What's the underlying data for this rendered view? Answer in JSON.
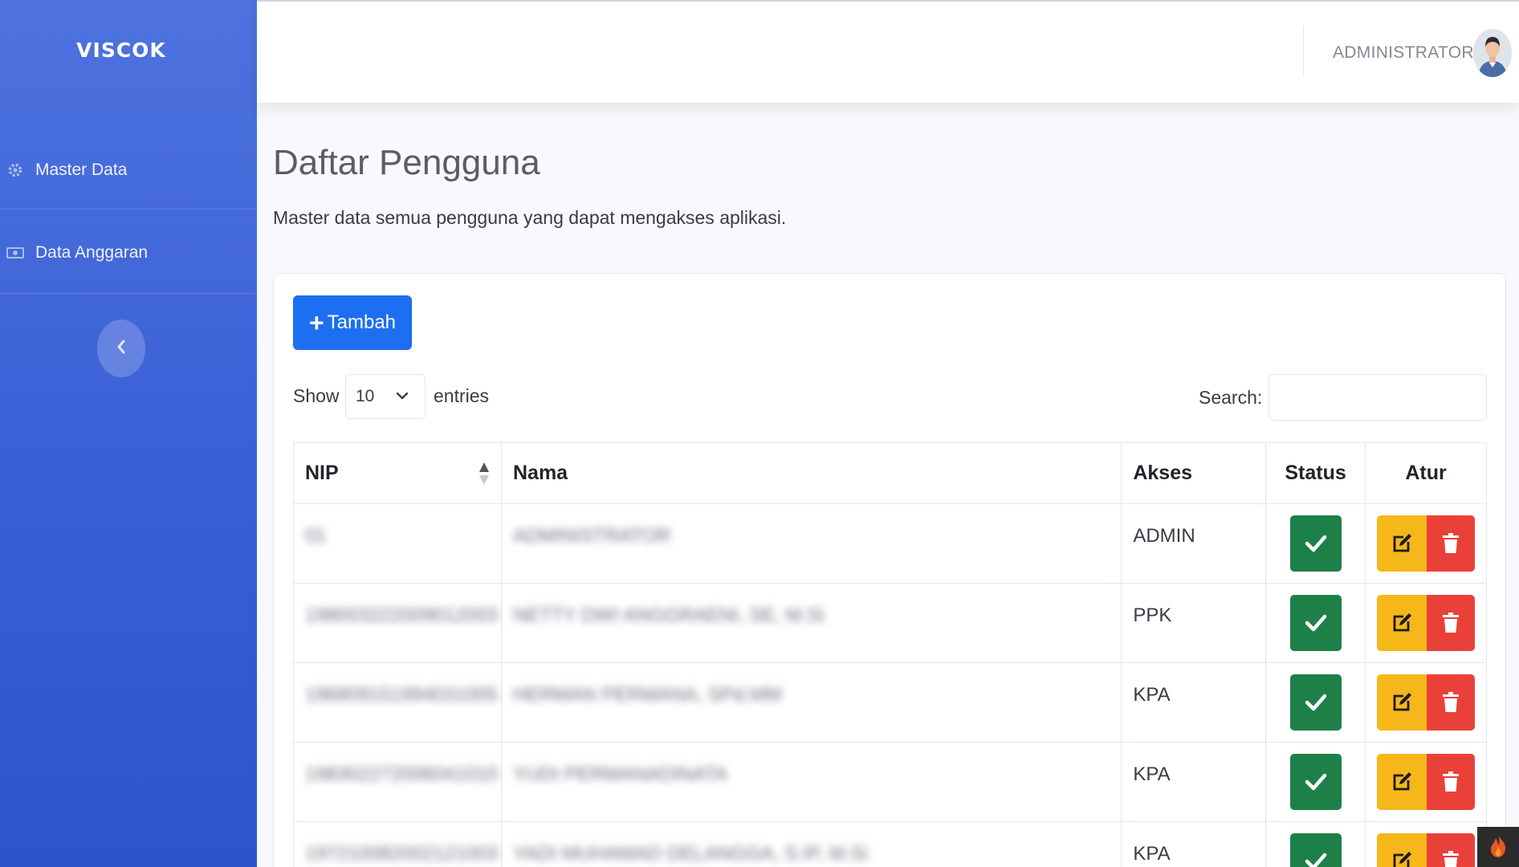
{
  "sidebar": {
    "brand": "VISCOK",
    "items": [
      {
        "label": "Master Data",
        "icon": "gear-icon"
      },
      {
        "label": "Data Anggaran",
        "icon": "money-bill-icon"
      }
    ],
    "collapse_icon": "chevron-left-icon"
  },
  "topbar": {
    "user_name": "ADMINISTRATOR"
  },
  "page": {
    "title": "Daftar Pengguna",
    "description": "Master data semua pengguna yang dapat mengakses aplikasi."
  },
  "toolbar": {
    "add_label": "Tambah",
    "show_label": "Show",
    "entries_value": "10",
    "entries_label": "entries",
    "search_label": "Search:",
    "search_value": ""
  },
  "table": {
    "columns": [
      "NIP",
      "Nama",
      "Akses",
      "Status",
      "Atur"
    ],
    "rows": [
      {
        "nip": "01",
        "nama": "ADMINISTRATOR",
        "akses": "ADMIN"
      },
      {
        "nip": "198003222009012003",
        "nama": "NETTY DWI ANGGRAENI, SE, M.Si",
        "akses": "PPK"
      },
      {
        "nip": "196809151994031005",
        "nama": "HERMAN PERMANA, SPd.MM",
        "akses": "KPA"
      },
      {
        "nip": "198302272006041010",
        "nama": "YUDI PERMANADINATA",
        "akses": "KPA"
      },
      {
        "nip": "197210082002121003",
        "nama": "YADI MUHAMAD DELANGGA, S.IP, M.Si",
        "akses": "KPA"
      }
    ]
  },
  "colors": {
    "sidebar": "#4e73df",
    "primary": "#1d6ff2",
    "success": "#1e8049",
    "warning": "#f6b71a",
    "danger": "#e9413a"
  }
}
